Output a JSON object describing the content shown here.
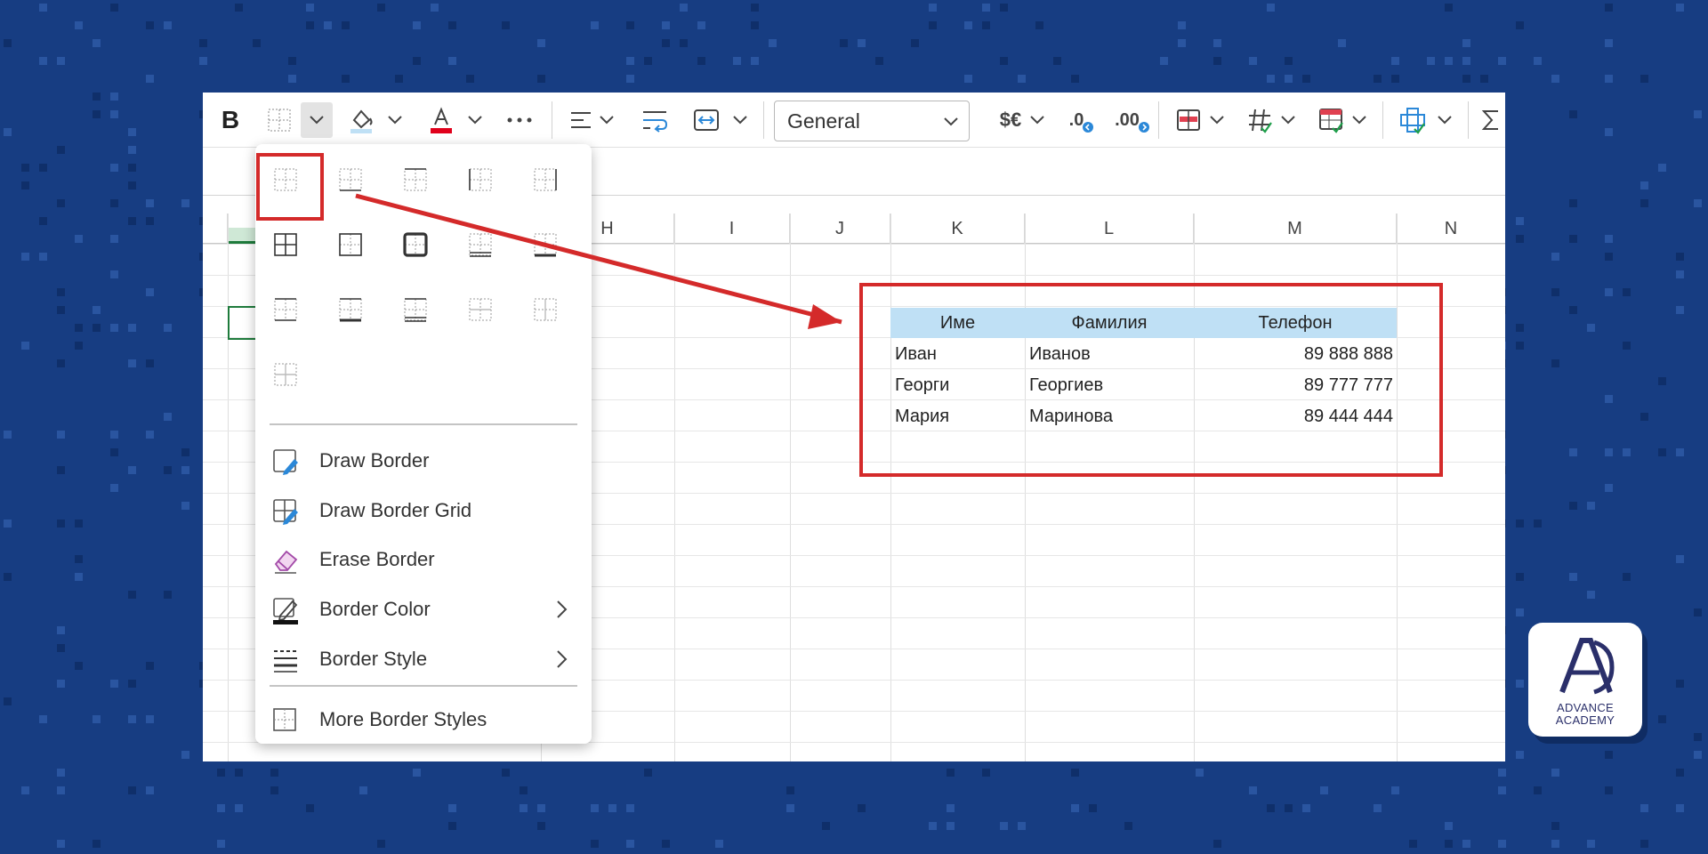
{
  "colors": {
    "background": "#173d82",
    "accent_red": "#d42a2a",
    "header_fill": "#bfe0f5",
    "selected_green": "#1e7b3c"
  },
  "toolbar": {
    "bold_label": "B",
    "number_format": "General",
    "currency_label": "$€",
    "decrease_decimal_label": ".0",
    "increase_decimal_label": ".00",
    "icons": [
      "borders-icon",
      "fill-color-icon",
      "font-color-icon",
      "more-icon",
      "align-icon",
      "wrap-text-icon",
      "merge-icon",
      "conditional-format-icon",
      "number-format-icon",
      "format-as-table-icon",
      "cell-styles-icon",
      "sum-icon"
    ]
  },
  "columns": [
    "H",
    "I",
    "J",
    "K",
    "L",
    "M",
    "N"
  ],
  "table": {
    "headers": [
      "Име",
      "Фамилия",
      "Телефон"
    ],
    "rows": [
      [
        "Иван",
        "Иванов",
        "89 888 888"
      ],
      [
        "Георги",
        "Георгиев",
        "89 777 777"
      ],
      [
        "Мария",
        "Маринова",
        "89 444 444"
      ]
    ]
  },
  "menu": {
    "border_presets": [
      "no-border",
      "bottom-border",
      "top-border",
      "left-border",
      "right-border",
      "all-borders",
      "outside-borders",
      "thick-outside-border",
      "bottom-double-border",
      "thick-bottom-border",
      "top-bottom-border",
      "top-thick-bottom-border",
      "top-double-bottom-border",
      "inside-horizontal-border",
      "inside-vertical-border",
      "inside-borders"
    ],
    "items": [
      {
        "label": "Draw Border",
        "icon": "draw-border-icon",
        "submenu": false
      },
      {
        "label": "Draw Border Grid",
        "icon": "draw-border-grid-icon",
        "submenu": false
      },
      {
        "label": "Erase Border",
        "icon": "eraser-icon",
        "submenu": false
      },
      {
        "label": "Border Color",
        "icon": "border-color-icon",
        "submenu": true
      },
      {
        "label": "Border Style",
        "icon": "border-style-icon",
        "submenu": true
      },
      {
        "label": "More Border Styles",
        "icon": "more-border-styles-icon",
        "submenu": false
      }
    ]
  },
  "logo": {
    "line1": "ADVANCE",
    "line2": "ACADEMY"
  }
}
